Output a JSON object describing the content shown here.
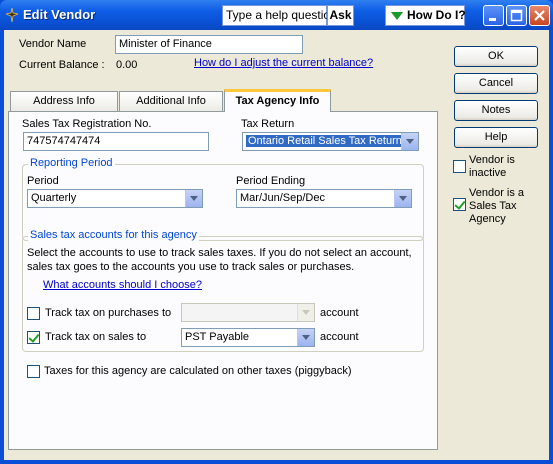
{
  "window": {
    "title": "Edit Vendor",
    "help_placeholder": "Type a help question",
    "ask_label": "Ask",
    "how_do_i_label": "How Do I?"
  },
  "vendor": {
    "name_label": "Vendor Name",
    "name_value": "Minister of Finance",
    "balance_label": "Current Balance :",
    "balance_value": "0.00",
    "adjust_link": "How do I adjust the current balance?"
  },
  "tabs": [
    {
      "label": "Address Info"
    },
    {
      "label": "Additional Info"
    },
    {
      "label": "Tax Agency Info",
      "active": true
    }
  ],
  "tax_agency": {
    "reg_label": "Sales Tax Registration No.",
    "reg_value": "747574747474",
    "return_label": "Tax Return",
    "return_value": "Ontario Retail Sales Tax Return",
    "reporting_period_title": "Reporting Period",
    "period_label": "Period",
    "period_value": "Quarterly",
    "period_ending_label": "Period Ending",
    "period_ending_value": "Mar/Jun/Sep/Dec",
    "accounts_title": "Sales tax accounts for this agency",
    "accounts_desc_1": "Select the accounts to use to track sales taxes. If you do not select an account,",
    "accounts_desc_2": "sales tax goes to the accounts you use to track sales or purchases.",
    "accounts_link": "What accounts should I choose?",
    "track_purchases_label": "Track tax on purchases to",
    "track_purchases_checked": false,
    "track_purchases_value": "",
    "track_sales_label": "Track tax on sales to",
    "track_sales_checked": true,
    "track_sales_value": "PST Payable",
    "account_suffix": "account",
    "piggyback_label": "Taxes for this agency are calculated on other taxes (piggyback)",
    "piggyback_checked": false
  },
  "side": {
    "ok_label": "OK",
    "cancel_label": "Cancel",
    "notes_label": "Notes",
    "help_label": "Help",
    "inactive_line1": "Vendor is",
    "inactive_line2": "inactive",
    "inactive_checked": false,
    "agency_line1": "Vendor is a",
    "agency_line2": "Sales Tax",
    "agency_line3": "Agency",
    "agency_checked": true
  },
  "colors": {
    "title_bar": "#0a52d6",
    "dialog_bg": "#ece9d8",
    "group_title": "#0046d5",
    "link": "#0000cc",
    "check_mark": "#21a121"
  }
}
